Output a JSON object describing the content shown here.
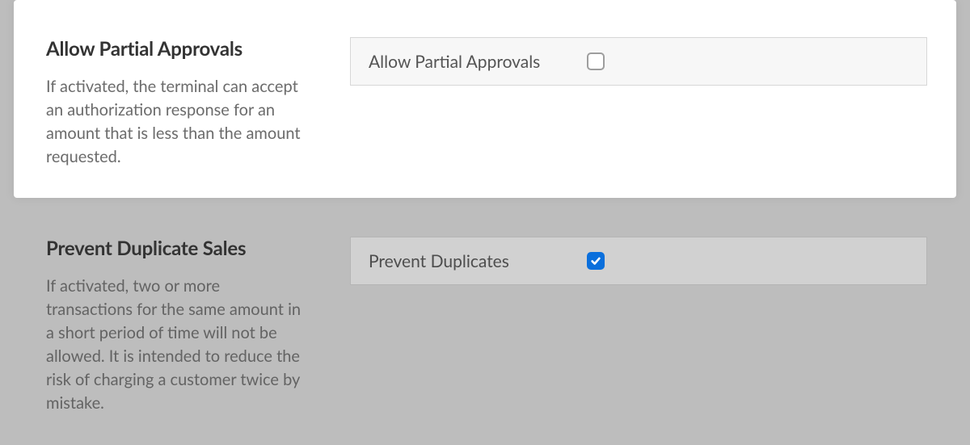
{
  "settings": [
    {
      "title": "Allow Partial Approvals",
      "description": "If activated, the terminal can accept an authorization response for an amount that is less than the amount requested.",
      "control_label": "Allow Partial Approvals",
      "checked": false,
      "highlighted": true
    },
    {
      "title": "Prevent Duplicate Sales",
      "description": "If activated, two or more transactions for the same amount in a short period of time will not be allowed. It is intended to reduce the risk of charging a customer twice by mistake.",
      "control_label": "Prevent Duplicates",
      "checked": true,
      "highlighted": false
    }
  ]
}
